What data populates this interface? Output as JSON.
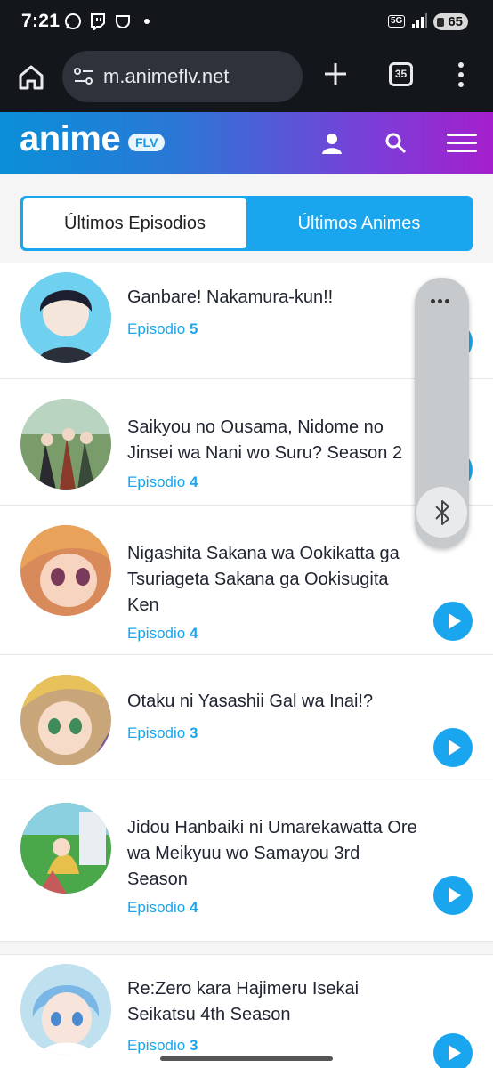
{
  "status_bar": {
    "time": "7:21",
    "network": "5G",
    "battery": "65"
  },
  "browser": {
    "url": "m.animeflv.net",
    "tab_count": "35"
  },
  "site": {
    "logo_text": "anime",
    "logo_badge": "FLV"
  },
  "tabs": [
    {
      "label": "Últimos Episodios",
      "active": true
    },
    {
      "label": "Últimos Animes",
      "active": false
    }
  ],
  "episodes": [
    {
      "title": "Ganbare! Nakamura-kun!!",
      "episode_label": "Episodio",
      "episode_number": "5"
    },
    {
      "title": "Saikyou no Ousama, Nidome no Jinsei wa Nani wo Suru? Season 2",
      "episode_label": "Episodio",
      "episode_number": "4"
    },
    {
      "title": "Nigashita Sakana wa Ookikatta ga Tsuriageta Sakana ga Ookisugita Ken",
      "episode_label": "Episodio",
      "episode_number": "4"
    },
    {
      "title": "Otaku ni Yasashii Gal wa Inai!?",
      "episode_label": "Episodio",
      "episode_number": "3"
    },
    {
      "title": "Jidou Hanbaiki ni Umarekawatta Ore wa Meikyuu wo Samayou 3rd Season",
      "episode_label": "Episodio",
      "episode_number": "4"
    },
    {
      "title": "Re:Zero kara Hajimeru Isekai Seikatsu 4th Season",
      "episode_label": "Episodio",
      "episode_number": "3"
    }
  ],
  "colors": {
    "accent": "#1aa6ef",
    "header_start": "#0a8fd8",
    "header_end": "#a51fcd",
    "browser_bg": "#13161b"
  }
}
